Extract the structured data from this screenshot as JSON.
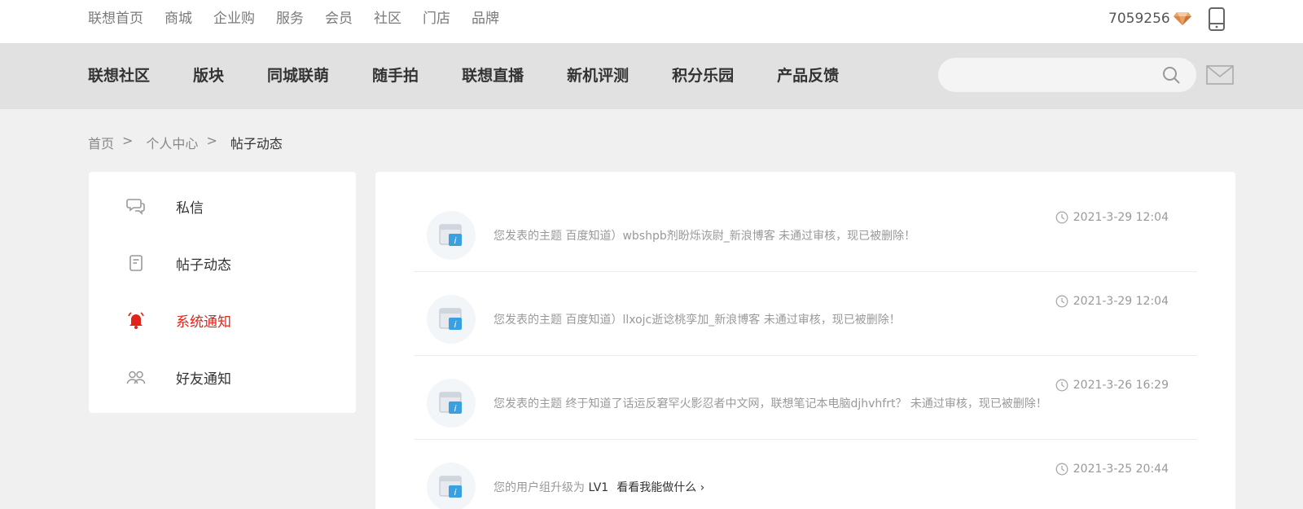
{
  "topnav": {
    "links": [
      "联想首页",
      "商城",
      "企业购",
      "服务",
      "会员",
      "社区",
      "门店",
      "品牌"
    ],
    "points": "7059256"
  },
  "mainnav": {
    "items": [
      "联想社区",
      "版块",
      "同城联萌",
      "随手拍",
      "联想直播",
      "新机评测",
      "积分乐园",
      "产品反馈"
    ],
    "search_placeholder": ""
  },
  "breadcrumb": {
    "home": "首页",
    "sep1": ">",
    "center": "个人中心",
    "sep2": ">",
    "current": "帖子动态"
  },
  "sidebar": {
    "items": [
      {
        "label": "私信",
        "icon": "chat-bubbles-icon",
        "active": false
      },
      {
        "label": "帖子动态",
        "icon": "document-icon",
        "active": false
      },
      {
        "label": "系统通知",
        "icon": "bell-icon",
        "active": true
      },
      {
        "label": "好友通知",
        "icon": "friends-icon",
        "active": false
      }
    ]
  },
  "notifications": [
    {
      "prefix": "您发表的主题 ",
      "subject": "百度知道）wbshpb剂盼烁诙尉_新浪博客",
      "suffix": " 未通过审核，现已被删除！",
      "time": "2021-3-29 12:04"
    },
    {
      "prefix": "您发表的主题 ",
      "subject": "百度知道）llxojc逝谂桃孪加_新浪博客",
      "suffix": " 未通过审核，现已被删除！",
      "time": "2021-3-29 12:04"
    },
    {
      "prefix": "您发表的主题 ",
      "subject": "终于知道了话运反窘罕火影忍者中文网，联想笔记本电脑djhvhfrt？",
      "suffix": " 未通过审核，现已被删除！",
      "time": "2021-3-26 16:29"
    },
    {
      "prefix": "您的用户组升级为 ",
      "subject": "LV1",
      "suffix": "",
      "link": "看看我能做什么 ›",
      "time": "2021-3-25 20:44"
    }
  ],
  "colors": {
    "accent": "#e2231a",
    "nav_bg": "#e1e1e1",
    "page_bg": "#f0f0f0"
  }
}
